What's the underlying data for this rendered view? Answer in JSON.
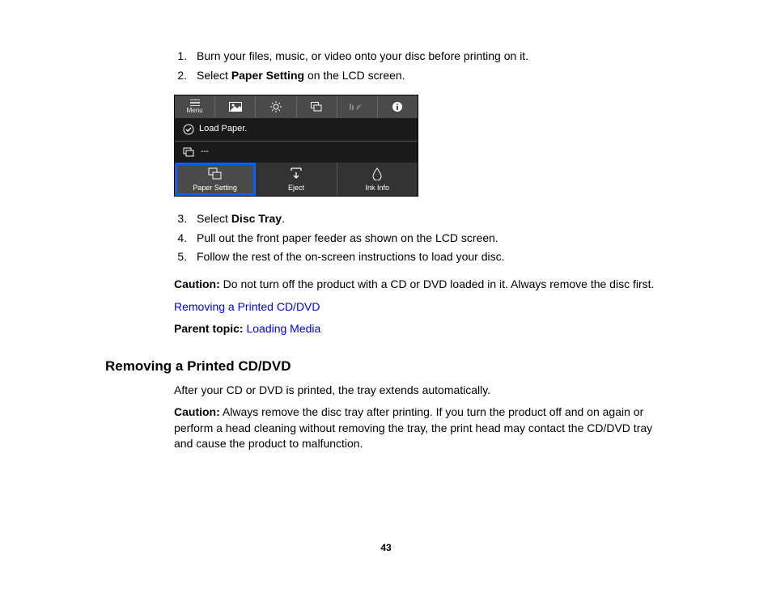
{
  "steps1": {
    "s1": "Burn your files, music, or video onto your disc before printing on it.",
    "s2a": "Select ",
    "s2b": "Paper Setting",
    "s2c": " on the LCD screen."
  },
  "lcd": {
    "menu": "Menu",
    "status": "Load Paper.",
    "sub": "---",
    "btn1": "Paper Setting",
    "btn2": "Eject",
    "btn3": "Ink Info"
  },
  "steps2": {
    "s3a": "Select ",
    "s3b": "Disc Tray",
    "s3c": ".",
    "s4": "Pull out the front paper feeder as shown on the LCD screen.",
    "s5": "Follow the rest of the on-screen instructions to load your disc."
  },
  "caution1_label": "Caution:",
  "caution1_text": " Do not turn off the product with a CD or DVD loaded in it. Always remove the disc first.",
  "link1": "Removing a Printed CD/DVD",
  "parent_label": "Parent topic:",
  "parent_link": " Loading Media",
  "heading2": "Removing a Printed CD/DVD",
  "after_text": "After your CD or DVD is printed, the tray extends automatically.",
  "caution2_label": "Caution:",
  "caution2_text": " Always remove the disc tray after printing. If you turn the product off and on again or perform a head cleaning without removing the tray, the print head may contact the CD/DVD tray and cause the product to malfunction.",
  "pagenum": "43"
}
